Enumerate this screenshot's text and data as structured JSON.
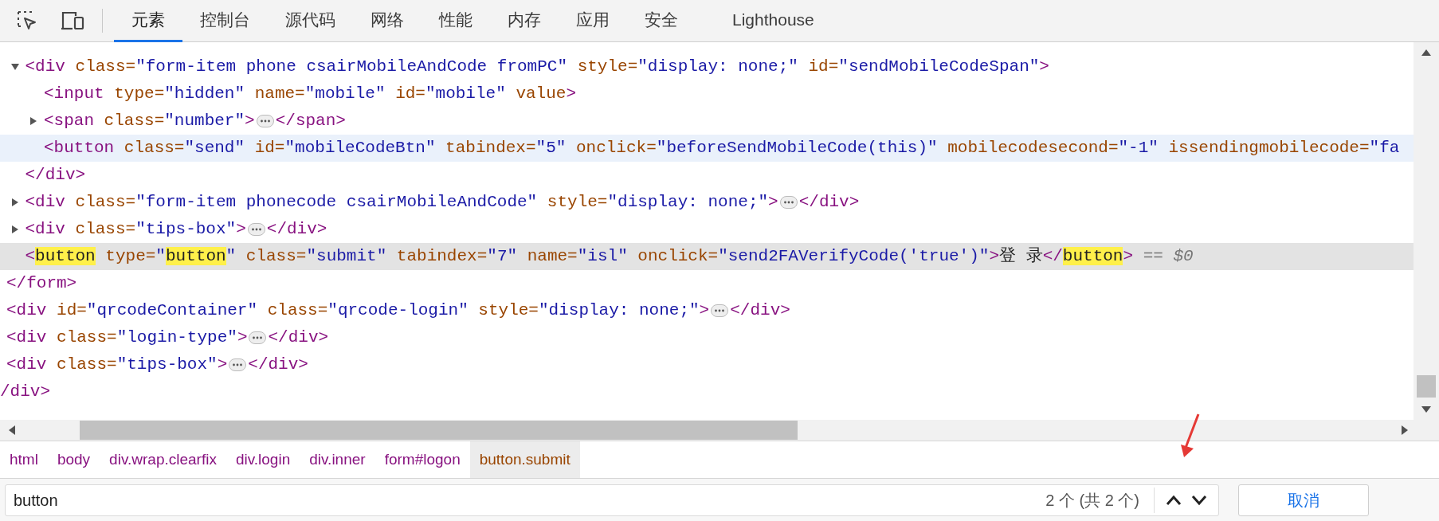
{
  "toolbar": {
    "tabs": [
      {
        "label": "元素",
        "selected": true
      },
      {
        "label": "控制台",
        "selected": false
      },
      {
        "label": "源代码",
        "selected": false
      },
      {
        "label": "网络",
        "selected": false
      },
      {
        "label": "性能",
        "selected": false
      },
      {
        "label": "内存",
        "selected": false
      },
      {
        "label": "应用",
        "selected": false
      },
      {
        "label": "安全",
        "selected": false
      },
      {
        "label": "Lighthouse",
        "selected": false
      }
    ]
  },
  "dom_tree": {
    "nodes": [
      {
        "close": [
          {
            "kind": "tag",
            "text": "</form>"
          }
        ],
        "children": [
          {
            "selected": false,
            "hovered": false,
            "expanded": true,
            "line": [
              {
                "kind": "tag",
                "text": "<div"
              },
              {
                "kind": "attr",
                "text": " class="
              },
              {
                "kind": "value",
                "text": "\"form-item phone csairMobileAndCode fromPC\""
              },
              {
                "kind": "attr",
                "text": " style="
              },
              {
                "kind": "value",
                "text": "\"display: none;\""
              },
              {
                "kind": "attr",
                "text": " id="
              },
              {
                "kind": "value",
                "text": "\"sendMobileCodeSpan\""
              },
              {
                "kind": "tag",
                "text": ">"
              }
            ],
            "close": [
              {
                "kind": "tag",
                "text": "</div>"
              }
            ],
            "children": [
              {
                "selected": false,
                "hovered": false,
                "line": [
                  {
                    "kind": "tag",
                    "text": "<input"
                  },
                  {
                    "kind": "attr",
                    "text": " type="
                  },
                  {
                    "kind": "value",
                    "text": "\"hidden\""
                  },
                  {
                    "kind": "attr",
                    "text": " name="
                  },
                  {
                    "kind": "value",
                    "text": "\"mobile\""
                  },
                  {
                    "kind": "attr",
                    "text": " id="
                  },
                  {
                    "kind": "value",
                    "text": "\"mobile\""
                  },
                  {
                    "kind": "attr",
                    "text": " value"
                  },
                  {
                    "kind": "tag",
                    "text": ">"
                  }
                ]
              },
              {
                "selected": false,
                "hovered": false,
                "expanded": false,
                "line": [
                  {
                    "kind": "tag",
                    "text": "<span"
                  },
                  {
                    "kind": "attr",
                    "text": " class="
                  },
                  {
                    "kind": "value",
                    "text": "\"number\""
                  },
                  {
                    "kind": "tag",
                    "text": ">"
                  },
                  {
                    "kind": "ellipsis"
                  },
                  {
                    "kind": "tag",
                    "text": "</span>"
                  }
                ]
              },
              {
                "selected": false,
                "hovered": true,
                "line": [
                  {
                    "kind": "tag",
                    "text": "<button"
                  },
                  {
                    "kind": "attr",
                    "text": " class="
                  },
                  {
                    "kind": "value",
                    "text": "\"send\""
                  },
                  {
                    "kind": "attr",
                    "text": " id="
                  },
                  {
                    "kind": "value",
                    "text": "\"mobileCodeBtn\""
                  },
                  {
                    "kind": "attr",
                    "text": " tabindex="
                  },
                  {
                    "kind": "value",
                    "text": "\"5\""
                  },
                  {
                    "kind": "attr",
                    "text": " onclick="
                  },
                  {
                    "kind": "value",
                    "text": "\"beforeSendMobileCode(this)\""
                  },
                  {
                    "kind": "attr",
                    "text": " mobilecodesecond="
                  },
                  {
                    "kind": "value",
                    "text": "\"-1\""
                  },
                  {
                    "kind": "attr",
                    "text": " issendingmobilecode="
                  },
                  {
                    "kind": "value",
                    "text": "\"fa"
                  }
                ]
              }
            ]
          },
          {
            "selected": false,
            "hovered": false,
            "expanded": false,
            "line": [
              {
                "kind": "tag",
                "text": "<div"
              },
              {
                "kind": "attr",
                "text": " class="
              },
              {
                "kind": "value",
                "text": "\"form-item phonecode csairMobileAndCode\""
              },
              {
                "kind": "attr",
                "text": " style="
              },
              {
                "kind": "value",
                "text": "\"display: none;\""
              },
              {
                "kind": "tag",
                "text": ">"
              },
              {
                "kind": "ellipsis"
              },
              {
                "kind": "tag",
                "text": "</div>"
              }
            ]
          },
          {
            "selected": false,
            "hovered": false,
            "expanded": false,
            "line": [
              {
                "kind": "tag",
                "text": "<div"
              },
              {
                "kind": "attr",
                "text": " class="
              },
              {
                "kind": "value",
                "text": "\"tips-box\""
              },
              {
                "kind": "tag",
                "text": ">"
              },
              {
                "kind": "ellipsis"
              },
              {
                "kind": "tag",
                "text": "</div>"
              }
            ]
          },
          {
            "selected": true,
            "hovered": false,
            "line": [
              {
                "kind": "tag",
                "text": "<"
              },
              {
                "kind": "match",
                "text": "button"
              },
              {
                "kind": "attr",
                "text": " type="
              },
              {
                "kind": "value",
                "text": "\""
              },
              {
                "kind": "match",
                "text": "button"
              },
              {
                "kind": "value",
                "text": "\""
              },
              {
                "kind": "attr",
                "text": " class="
              },
              {
                "kind": "value",
                "text": "\"submit\""
              },
              {
                "kind": "attr",
                "text": " tabindex="
              },
              {
                "kind": "value",
                "text": "\"7\""
              },
              {
                "kind": "attr",
                "text": " name="
              },
              {
                "kind": "value",
                "text": "\"isl\""
              },
              {
                "kind": "attr",
                "text": " onclick="
              },
              {
                "kind": "value",
                "text": "\"send2FAVerifyCode('true')\""
              },
              {
                "kind": "tag",
                "text": ">"
              },
              {
                "kind": "text",
                "text": "登 录"
              },
              {
                "kind": "tag",
                "text": "</"
              },
              {
                "kind": "match",
                "text": "button"
              },
              {
                "kind": "tag",
                "text": ">"
              },
              {
                "kind": "console",
                "text": " == $0"
              }
            ]
          }
        ]
      },
      {
        "selected": false,
        "hovered": false,
        "line": [
          {
            "kind": "tag",
            "text": "<div"
          },
          {
            "kind": "attr",
            "text": " id="
          },
          {
            "kind": "value",
            "text": "\"qrcodeContainer\""
          },
          {
            "kind": "attr",
            "text": " class="
          },
          {
            "kind": "value",
            "text": "\"qrcode-login\""
          },
          {
            "kind": "attr",
            "text": " style="
          },
          {
            "kind": "value",
            "text": "\"display: none;\""
          },
          {
            "kind": "tag",
            "text": ">"
          },
          {
            "kind": "ellipsis"
          },
          {
            "kind": "tag",
            "text": "</div>"
          }
        ]
      },
      {
        "selected": false,
        "hovered": false,
        "line": [
          {
            "kind": "tag",
            "text": "<div"
          },
          {
            "kind": "attr",
            "text": " class="
          },
          {
            "kind": "value",
            "text": "\"login-type\""
          },
          {
            "kind": "tag",
            "text": ">"
          },
          {
            "kind": "ellipsis"
          },
          {
            "kind": "tag",
            "text": "</div>"
          }
        ]
      },
      {
        "selected": false,
        "hovered": false,
        "line": [
          {
            "kind": "tag",
            "text": "<div"
          },
          {
            "kind": "attr",
            "text": " class="
          },
          {
            "kind": "value",
            "text": "\"tips-box\""
          },
          {
            "kind": "tag",
            "text": ">"
          },
          {
            "kind": "ellipsis"
          },
          {
            "kind": "tag",
            "text": "</div>"
          }
        ]
      }
    ],
    "outer_close": [
      {
        "kind": "tag",
        "text": "/div>"
      }
    ]
  },
  "breadcrumbs": [
    {
      "label": "html",
      "selected": false
    },
    {
      "label": "body",
      "selected": false
    },
    {
      "label": "div.wrap.clearfix",
      "selected": false
    },
    {
      "label": "div.login",
      "selected": false
    },
    {
      "label": "div.inner",
      "selected": false
    },
    {
      "label": "form#logon",
      "selected": false
    },
    {
      "label": "button.submit",
      "selected": true
    }
  ],
  "search": {
    "value": "button",
    "count": "2 个 (共 2 个)",
    "cancel": "取消"
  }
}
